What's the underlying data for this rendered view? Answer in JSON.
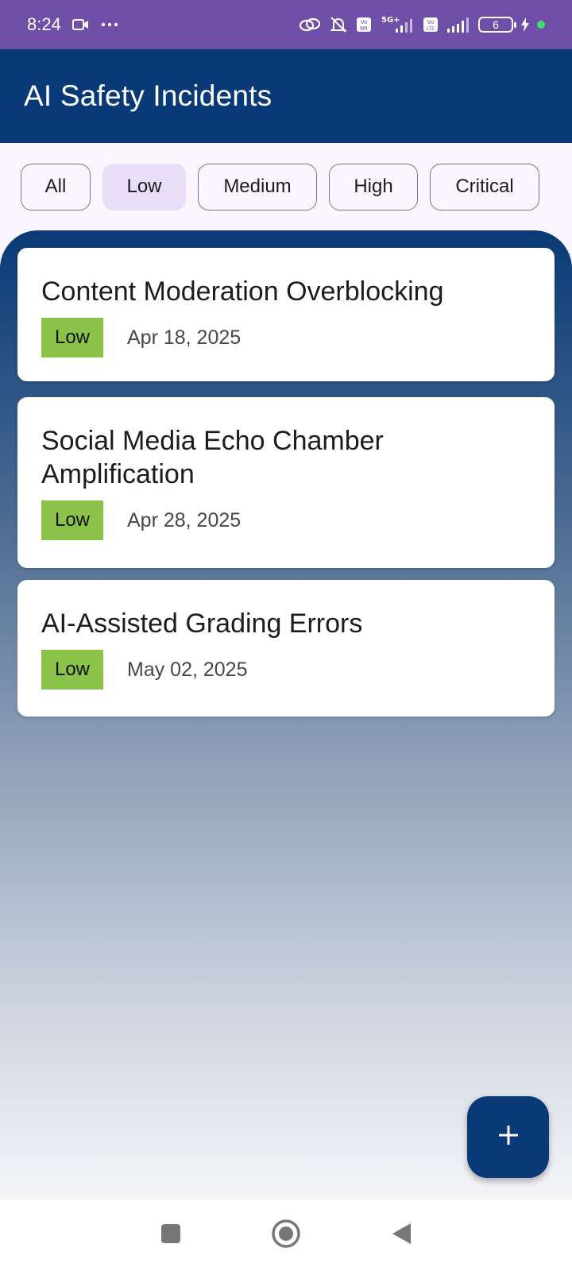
{
  "status_bar": {
    "time": "8:24",
    "battery_level": "6",
    "icons": [
      "video-camera-icon",
      "more-dots-icon",
      "link-icon",
      "bell-off-icon",
      "vonr-icon",
      "signal-5g-icon",
      "volte-icon",
      "signal-icon",
      "battery-icon",
      "charging-icon"
    ]
  },
  "app_bar": {
    "title": "AI Safety Incidents",
    "background": "#093a77"
  },
  "filters": {
    "options": [
      "All",
      "Low",
      "Medium",
      "High",
      "Critical"
    ],
    "selected": "Low"
  },
  "incidents": [
    {
      "title": "Content Moderation Overblocking",
      "severity": "Low",
      "date": "Apr 18, 2025"
    },
    {
      "title": "Social Media Echo Chamber Amplification",
      "severity": "Low",
      "date": "Apr 28, 2025"
    },
    {
      "title": "AI-Assisted Grading Errors",
      "severity": "Low",
      "date": "May 02, 2025"
    }
  ],
  "colors": {
    "primary": "#093a77",
    "status_bar": "#6f4ea7",
    "severity_low": "#8bc34a",
    "chip_selected": "#e8def8"
  },
  "fab": {
    "icon": "plus-icon"
  },
  "nav_bar": {
    "icons": [
      "recents-square-icon",
      "home-circle-icon",
      "back-triangle-icon"
    ]
  }
}
